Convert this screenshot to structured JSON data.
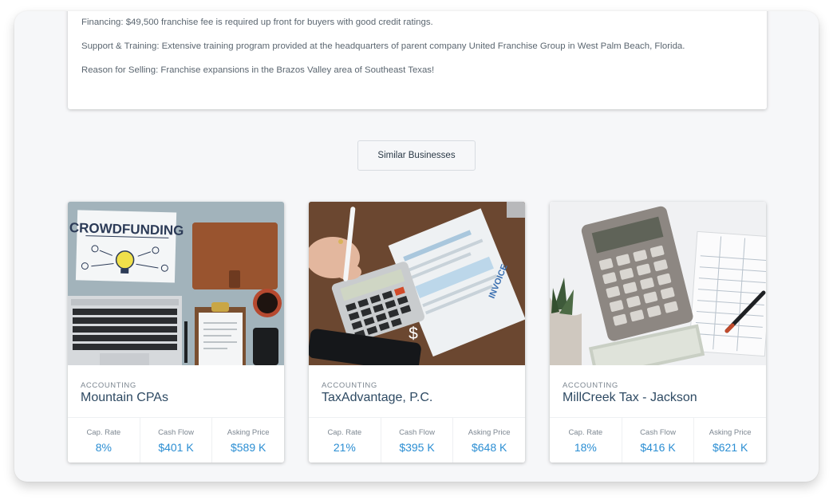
{
  "description": {
    "lines": [
      "Financing: $49,500 franchise fee is required up front for buyers with good credit ratings.",
      "Support & Training: Extensive training program provided at the headquarters of parent company United Franchise Group in West Palm Beach, Florida.",
      "Reason for Selling: Franchise expansions in the Brazos Valley area of Southeast Texas!"
    ]
  },
  "similar_button": {
    "label": "Similar Businesses"
  },
  "listings": [
    {
      "category": "ACCOUNTING",
      "name": "Mountain CPAs",
      "image_text": "CROWDFUNDING",
      "stats": [
        {
          "label": "Cap. Rate",
          "value": "8%"
        },
        {
          "label": "Cash Flow",
          "value": "$401 K"
        },
        {
          "label": "Asking Price",
          "value": "$589 K"
        }
      ]
    },
    {
      "category": "ACCOUNTING",
      "name": "TaxAdvantage, P.C.",
      "image_text": "INVOICE",
      "image_overlay": "$",
      "stats": [
        {
          "label": "Cap. Rate",
          "value": "21%"
        },
        {
          "label": "Cash Flow",
          "value": "$395 K"
        },
        {
          "label": "Asking Price",
          "value": "$648 K"
        }
      ]
    },
    {
      "category": "ACCOUNTING",
      "name": "MillCreek Tax - Jackson",
      "stats": [
        {
          "label": "Cap. Rate",
          "value": "18%"
        },
        {
          "label": "Cash Flow",
          "value": "$416 K"
        },
        {
          "label": "Asking Price",
          "value": "$621 K"
        }
      ]
    }
  ],
  "colors": {
    "accent_value": "#2b8ed3",
    "title_text": "#2e4a63",
    "page_background": "#f6f7f9"
  }
}
